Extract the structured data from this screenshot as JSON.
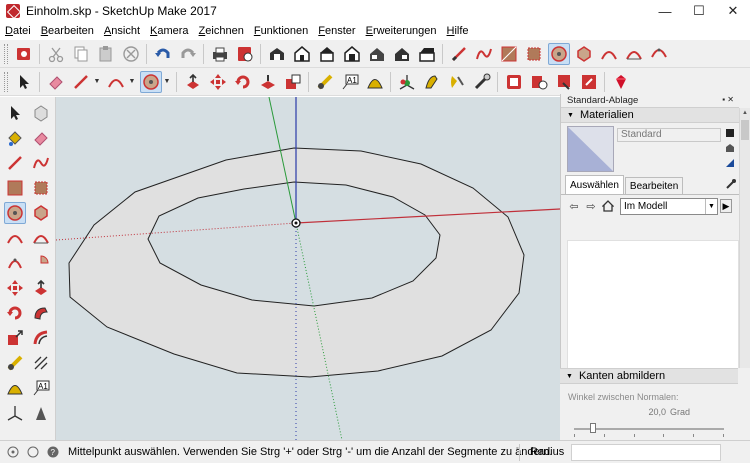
{
  "window": {
    "title": "Einholm.skp - SketchUp Make 2017",
    "controls": {
      "minimize": "—",
      "maximize": "☐",
      "close": "✕"
    }
  },
  "menu": [
    "Datei",
    "Bearbeiten",
    "Ansicht",
    "Kamera",
    "Zeichnen",
    "Funktionen",
    "Fenster",
    "Erweiterungen",
    "Hilfe"
  ],
  "toolbar1_icons": [
    "add-location-icon",
    "cut-icon",
    "copy-icon",
    "paste-icon",
    "delete-icon",
    "undo-icon",
    "redo-icon",
    "print-icon",
    "model-info-icon",
    "warehouse-icon",
    "iso-view-icon",
    "top-view-icon",
    "front-view-icon",
    "right-view-icon",
    "back-view-icon",
    "left-view-icon",
    "line-icon",
    "freehand-icon",
    "rectangle-icon",
    "rotated-rectangle-icon",
    "circle-icon",
    "polygon-icon",
    "arc-icon",
    "two-point-arc-icon",
    "three-point-arc-icon"
  ],
  "toolbar2_icons": [
    "select-icon",
    "eraser-icon",
    "pencil-line-icon",
    "arc-icon",
    "circle-icon",
    "push-pull-icon",
    "move-icon",
    "rotate-icon",
    "scale-icon",
    "offset-icon",
    "tape-measure-icon",
    "text-icon",
    "protractor-icon",
    "axes-icon",
    "3d-text-icon",
    "orbit-icon",
    "pan-icon",
    "zoom-icon",
    "zoom-extents-icon",
    "previous-view-icon",
    "warehouse-share-icon",
    "extension-warehouse-icon",
    "ruby-icon"
  ],
  "panel": {
    "title": "Standard-Ablage",
    "materials": {
      "header": "Materialien",
      "name_value": "Standard",
      "tabs": [
        "Auswählen",
        "Bearbeiten"
      ],
      "collection": "Im Modell"
    },
    "soften": {
      "header": "Kanten abmildern",
      "angle_label": "Winkel zwischen Normalen:",
      "angle_value": "20,0",
      "angle_unit": "Grad"
    }
  },
  "status": {
    "message": "Mittelpunkt auswählen. Verwenden Sie Strg '+' oder Strg '-' um die Anzahl der Segmente zu ändern.",
    "measure_label": "Radius",
    "measure_value": ""
  },
  "colors": {
    "viewport_bg": "#d5dee2",
    "face": "#e0e0e0",
    "edge": "#222222",
    "axis_red": "#c0303a",
    "axis_green": "#2a9a3a",
    "axis_blue": "#2a3aa8",
    "active_tool": "#c9dff5"
  }
}
